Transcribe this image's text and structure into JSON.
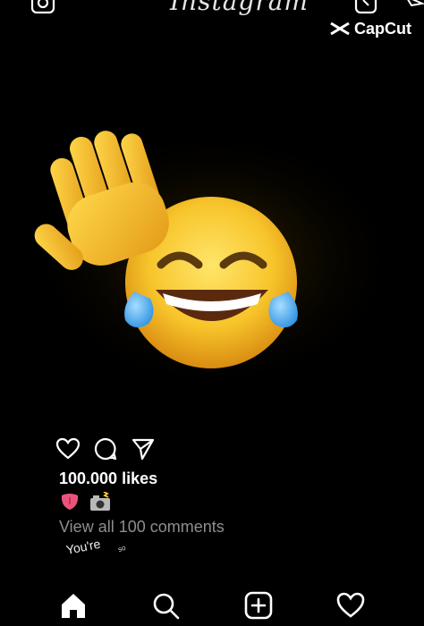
{
  "header": {
    "app_title": "Instagram",
    "icons": [
      "camera-icon",
      "igtv-icon",
      "send-icon"
    ]
  },
  "watermark": {
    "label": "CapCut"
  },
  "post": {
    "media_description_icons": [
      "waving-hand-icon",
      "face-with-tears-of-joy-icon"
    ],
    "likes": "100.000 likes",
    "caption_icons": [
      "tongue-icon",
      "camera-with-flash-icon"
    ],
    "comments_link": "View all 100 comments",
    "typed_text": "You're",
    "typed_text_small": "so"
  },
  "actions": [
    "heart-icon",
    "comment-icon",
    "share-icon"
  ],
  "bottom_nav": [
    "home-icon",
    "search-icon",
    "add-post-icon",
    "activity-heart-icon"
  ],
  "colors": {
    "background": "#000000",
    "text": "#ffffff",
    "muted_text": "#8e8e8e",
    "emoji_yellow": "#f7c52b"
  }
}
